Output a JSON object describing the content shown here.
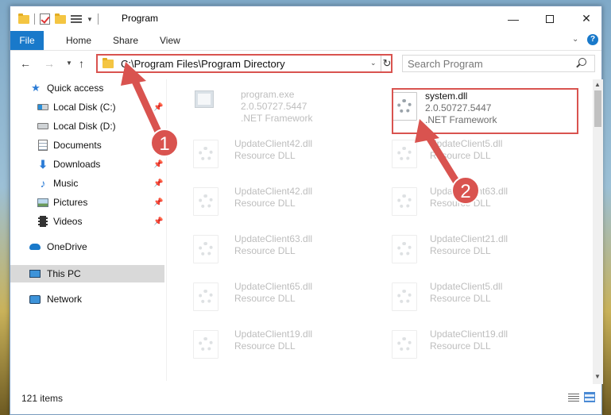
{
  "window": {
    "title": "Program"
  },
  "ribbon": {
    "tabs": [
      "File",
      "Home",
      "Share",
      "View"
    ]
  },
  "navigation": {
    "address": "C:\\Program Files\\Program Directory",
    "search_placeholder": "Search Program"
  },
  "sidebar": {
    "items": [
      {
        "label": "Quick access",
        "icon": "star-icon",
        "pinned": false
      },
      {
        "label": "Local Disk (C:)",
        "icon": "drive-icon",
        "pinned": true
      },
      {
        "label": "Local Disk (D:)",
        "icon": "drive-icon",
        "pinned": false
      },
      {
        "label": "Documents",
        "icon": "documents-icon",
        "pinned": false
      },
      {
        "label": "Downloads",
        "icon": "download-icon",
        "pinned": true
      },
      {
        "label": "Music",
        "icon": "music-icon",
        "pinned": true
      },
      {
        "label": "Pictures",
        "icon": "pictures-icon",
        "pinned": true
      },
      {
        "label": "Videos",
        "icon": "videos-icon",
        "pinned": true
      },
      {
        "label": "OneDrive",
        "icon": "cloud-icon",
        "pinned": false
      },
      {
        "label": "This PC",
        "icon": "computer-icon",
        "pinned": false,
        "selected": true
      },
      {
        "label": "Network",
        "icon": "network-icon",
        "pinned": false
      }
    ]
  },
  "files": [
    {
      "name": "program.exe",
      "version": "2.0.50727.5447",
      "description": ".NET Framework",
      "faded": true,
      "type": "exe"
    },
    {
      "name": "system.dll",
      "version": "2.0.50727.5447",
      "description": ".NET Framework",
      "faded": false,
      "highlighted": true,
      "type": "dll"
    },
    {
      "name": "UpdateClient42.dll",
      "description": "Resource DLL",
      "faded": true
    },
    {
      "name": "UpdateClient5.dll",
      "description": "Resource DLL",
      "faded": true
    },
    {
      "name": "UpdateClient42.dll",
      "description": "Resource DLL",
      "faded": true
    },
    {
      "name": "UpdateClient63.dll",
      "description": "Resource DLL",
      "faded": true
    },
    {
      "name": "UpdateClient63.dll",
      "description": "Resource DLL",
      "faded": true
    },
    {
      "name": "UpdateClient21.dll",
      "description": "Resource DLL",
      "faded": true
    },
    {
      "name": "UpdateClient65.dll",
      "description": "Resource DLL",
      "faded": true
    },
    {
      "name": "UpdateClient5.dll",
      "description": "Resource DLL",
      "faded": true
    },
    {
      "name": "UpdateClient19.dll",
      "description": "Resource DLL",
      "faded": true
    },
    {
      "name": "UpdateClient19.dll",
      "description": "Resource DLL",
      "faded": true
    }
  ],
  "annotations": {
    "step1": "1",
    "step2": "2",
    "color": "#d9534f"
  },
  "status": {
    "item_count": "121 items"
  }
}
